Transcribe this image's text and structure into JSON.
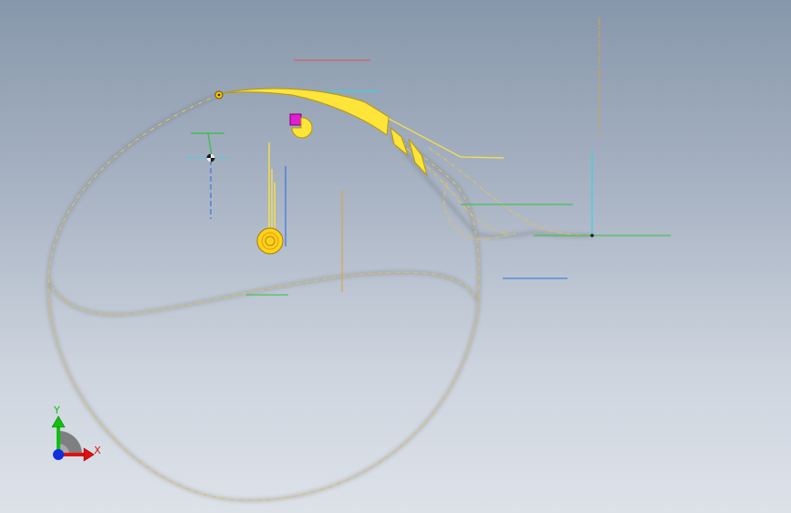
{
  "viewport": {
    "background_top": "#8797ab",
    "background_bottom": "#dde2e9"
  },
  "colors": {
    "sketch_curve": "#d8c070",
    "sketch_shadow": "#4a4a44",
    "feature_fill": "#ffe43a",
    "feature_edge": "#b89a00",
    "point_selected": "#e020d0",
    "ref_red": "#e05050",
    "ref_cyan": "#30d8e0",
    "ref_green": "#30c040",
    "ref_blue": "#3070e0",
    "ref_orange": "#e0a040",
    "triad_x": "#e01010",
    "triad_y": "#10c010",
    "triad_z": "#1030e0"
  },
  "triad": {
    "x_label": "X",
    "y_label": "Y"
  },
  "icons": {
    "origin": "origin-point-icon",
    "sketch_point": "sketch-point-icon",
    "coordinate_triad": "coordinate-triad-icon"
  }
}
